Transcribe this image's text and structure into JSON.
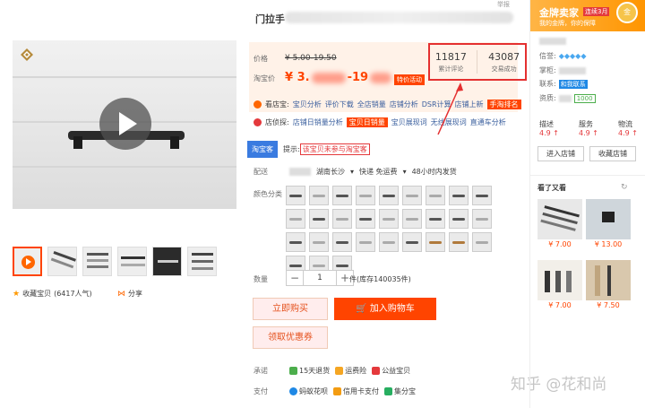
{
  "product": {
    "title": "门拉手",
    "report": "举报"
  },
  "price": {
    "label_price": "价格",
    "original_price": "¥ 5.00-19.50",
    "label_taobao": "淘宝价",
    "taobao_price_prefix": "¥ 3.",
    "taobao_price_mid": "-19",
    "promo_tag": "特价活动"
  },
  "stats": {
    "reviews_count": "11817",
    "reviews_label": "累计评论",
    "sales_count": "43087",
    "sales_label": "交易成功"
  },
  "tools_row1": {
    "name": "看店宝:",
    "items": [
      "宝贝分析",
      "评价下载",
      "全店销量",
      "店铺分析",
      "DSR计算",
      "店铺上新",
      "手淘排名"
    ]
  },
  "tools_row2": {
    "name": "店侦探:",
    "items": [
      "店铺日销量分析",
      "宝贝日销量",
      "宝贝展现词",
      "无线展现词",
      "直通车分析"
    ]
  },
  "tip": {
    "tag": "淘宝客",
    "prefix": "提示:",
    "text": "该宝贝未参与淘宝客"
  },
  "delivery": {
    "label": "配送",
    "destination": "湖南长沙",
    "shipping": "快递 免运费",
    "ship_time": "48小时内发货"
  },
  "color": {
    "label": "颜色分类"
  },
  "quantity": {
    "label": "数量",
    "value": "1",
    "minus": "−",
    "plus": "+",
    "stock": "件(库存140035件)"
  },
  "actions": {
    "buy_now": "立即购买",
    "add_to_cart": "加入购物车",
    "get_coupon": "领取优惠券"
  },
  "promise": {
    "label": "承诺",
    "items": [
      "15天退货",
      "运费险",
      "公益宝贝"
    ]
  },
  "payment": {
    "label": "支付",
    "items": [
      "蚂蚁花呗",
      "信用卡支付",
      "集分宝"
    ]
  },
  "gallery": {
    "favorite": "收藏宝贝",
    "favorite_count": "(6417人气)",
    "share": "分享"
  },
  "seller": {
    "badge_title": "金牌卖家",
    "badge_tag": "连续3月",
    "badge_sub": "我的金牌，你的保障",
    "medal": "金",
    "rep_label": "信誉:",
    "keeper_label": "掌柜:",
    "contact_label": "联系:",
    "contact_btn": "和我联系",
    "quali_label": "资质:",
    "quali_value": "1000",
    "scores": [
      {
        "label": "描述",
        "value": "4.9 ↑"
      },
      {
        "label": "服务",
        "value": "4.9 ↑"
      },
      {
        "label": "物流",
        "value": "4.9 ↑"
      }
    ],
    "enter_shop": "进入店铺",
    "fav_shop": "收藏店铺",
    "also_viewed": "看了又看",
    "recommendations": [
      {
        "price": "¥ 7.00"
      },
      {
        "price": "¥ 13.00"
      },
      {
        "price": "¥ 7.00"
      },
      {
        "price": "¥ 7.50"
      }
    ]
  },
  "watermark": "知乎 @花和尚",
  "colors": {
    "accent": "#ff4400",
    "price_red": "#f40",
    "highlight_box": "#e43030",
    "gold": "#ff9500"
  }
}
